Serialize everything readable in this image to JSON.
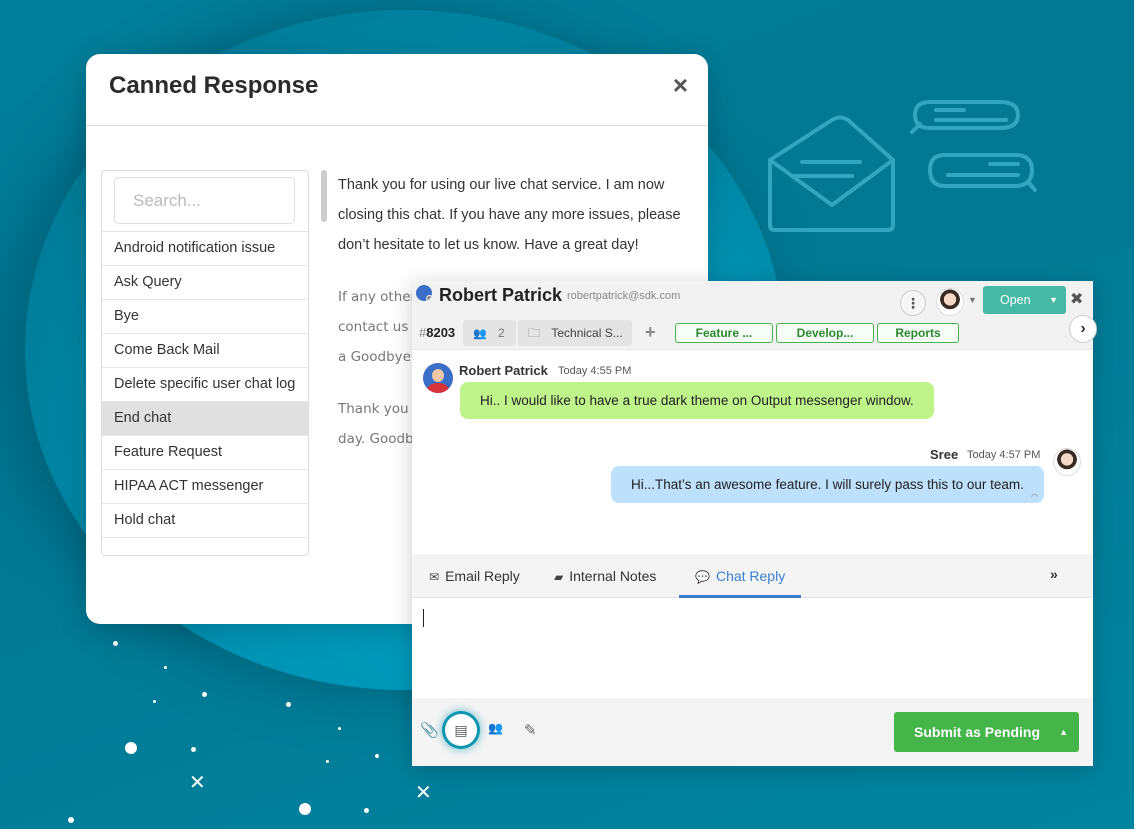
{
  "canned_response": {
    "title": "Canned Response",
    "close_icon": "×",
    "search": {
      "placeholder": "Search...",
      "value": ""
    },
    "items": [
      {
        "label": "Android notification issue"
      },
      {
        "label": "Ask Query"
      },
      {
        "label": "Bye"
      },
      {
        "label": "Come Back Mail"
      },
      {
        "label": "Delete specific user chat log"
      },
      {
        "label": "End chat",
        "active": true
      },
      {
        "label": "Feature Request"
      },
      {
        "label": "HIPAA ACT messenger"
      },
      {
        "label": "Hold chat"
      }
    ],
    "preview": {
      "p1": "Thank you for using our live chat service. I am now closing this chat. If you have any more issues, please don’t hesitate to let us know. Have a great day!",
      "p2": "If any other contact us a Goodbye.",
      "p3": "Thank you day. Goodb"
    }
  },
  "ticket": {
    "customer_name": "Robert Patrick",
    "customer_email": "robertpatrick@sdk.com",
    "more_icon": "⋮",
    "status_button": "Open",
    "close_icon": "✖",
    "ticket_id_prefix": "#",
    "ticket_id": "8203",
    "participants_count": "2",
    "department": "Technical S...",
    "add_icon": "+",
    "tags": [
      "Feature ...",
      "Develop...",
      "Reports"
    ],
    "next_icon": "›"
  },
  "messages": [
    {
      "sender": "Robert Patrick",
      "time": "Today 4:55 PM",
      "text": "Hi.. I would like to have a true dark theme on Output messenger window.",
      "direction": "in",
      "bubble_color": "#bef48a"
    },
    {
      "sender": "Sree",
      "time": "Today 4:57 PM",
      "text": "Hi...That’s an awesome feature. I will surely pass this to our team.",
      "direction": "out",
      "bubble_color": "#bde0fc"
    }
  ],
  "reply_tabs": [
    {
      "label": "Email Reply",
      "icon": "envelope-icon"
    },
    {
      "label": "Internal Notes",
      "icon": "note-icon"
    },
    {
      "label": "Chat Reply",
      "icon": "chat-icon",
      "active": true
    }
  ],
  "editor": {
    "value": ""
  },
  "footer": {
    "submit_label": "Submit as Pending",
    "icons": [
      "paperclip-icon",
      "canned-response-book-icon",
      "users-icon",
      "pencil-icon"
    ]
  },
  "colors": {
    "background": "#01809b",
    "accent_blue": "#3a7fcf",
    "open_status": "#46b8a4",
    "submit_green": "#43b549",
    "tag_green": "#45b34a"
  }
}
